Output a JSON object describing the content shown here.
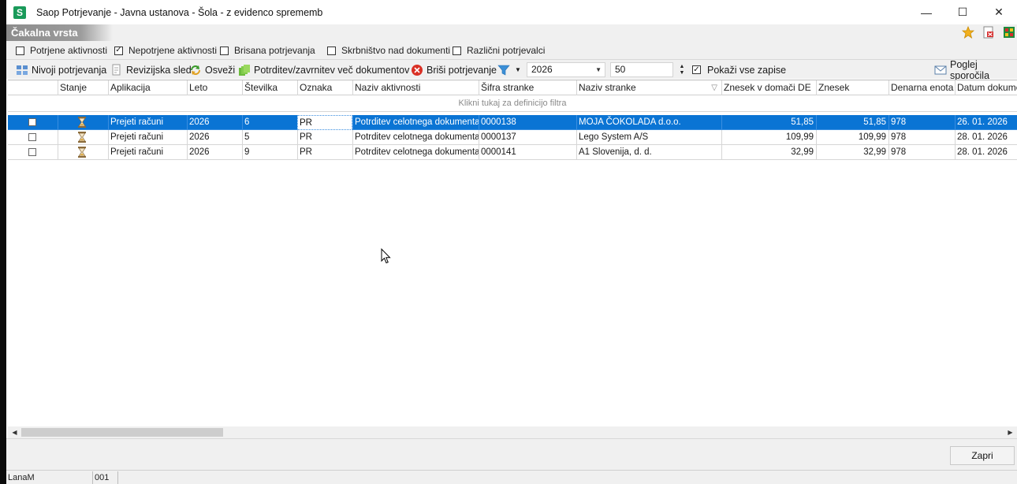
{
  "window": {
    "app_icon_letter": "S",
    "title": "Saop Potrjevanje - Javna ustanova - Šola - z evidenco sprememb",
    "minimize": "—",
    "maximize": "☐",
    "close": "✕"
  },
  "section": {
    "title": "Čakalna vrsta"
  },
  "filters": [
    {
      "label": "Potrjene aktivnosti",
      "checked": false
    },
    {
      "label": "Nepotrjene aktivnosti",
      "checked": true
    },
    {
      "label": "Brisana potrjevanja",
      "checked": false
    },
    {
      "label": "Skrbništvo nad dokumenti",
      "checked": false
    },
    {
      "label": "Različni potrjevalci",
      "checked": false
    }
  ],
  "toolbar": {
    "levels": "Nivoji potrjevanja",
    "audit": "Revizijska sled",
    "refresh": "Osveži",
    "confirm_multi": "Potrditev/zavrnitev več dokumentov",
    "delete": "Briši potrjevanje",
    "year": "2026",
    "count": "50",
    "show_all": "Pokaži vse zapise",
    "show_all_checked": true,
    "messages": "Poglej sporočila"
  },
  "grid": {
    "columns": [
      "",
      "Stanje",
      "Aplikacija",
      "Leto",
      "Številka",
      "Oznaka",
      "Naziv aktivnosti",
      "Šifra stranke",
      "Naziv stranke",
      "Znesek v domači DE",
      "Znesek",
      "Denarna enota",
      "Datum dokumen"
    ],
    "filter_hint": "Klikni tukaj za definicijo filtra",
    "rows": [
      {
        "aplikacija": "Prejeti računi",
        "leto": "2026",
        "stevilka": "6",
        "oznaka": "PR",
        "naziv_aktivnosti": "Potrditev celotnega dokumenta",
        "sifra": "0000138",
        "naziv_stranke": "MOJA ČOKOLADA d.o.o.",
        "znesek_domaci": "51,85",
        "znesek": "51,85",
        "enota": "978",
        "datum": "26. 01. 2026"
      },
      {
        "aplikacija": "Prejeti računi",
        "leto": "2026",
        "stevilka": "5",
        "oznaka": "PR",
        "naziv_aktivnosti": "Potrditev celotnega dokumenta",
        "sifra": "0000137",
        "naziv_stranke": "Lego System A/S",
        "znesek_domaci": "109,99",
        "znesek": "109,99",
        "enota": "978",
        "datum": "28. 01. 2026"
      },
      {
        "aplikacija": "Prejeti računi",
        "leto": "2026",
        "stevilka": "9",
        "oznaka": "PR",
        "naziv_aktivnosti": "Potrditev celotnega dokumenta",
        "sifra": "0000141",
        "naziv_stranke": "A1 Slovenija, d. d.",
        "znesek_domaci": "32,99",
        "znesek": "32,99",
        "enota": "978",
        "datum": "28. 01. 2026"
      }
    ]
  },
  "buttons": {
    "close": "Zapri"
  },
  "status": {
    "user": "LanaM",
    "code": "001"
  },
  "colors": {
    "selection": "#0a74d4",
    "chrome": "#f0f0f0",
    "section_header": "#8c8c8c"
  }
}
